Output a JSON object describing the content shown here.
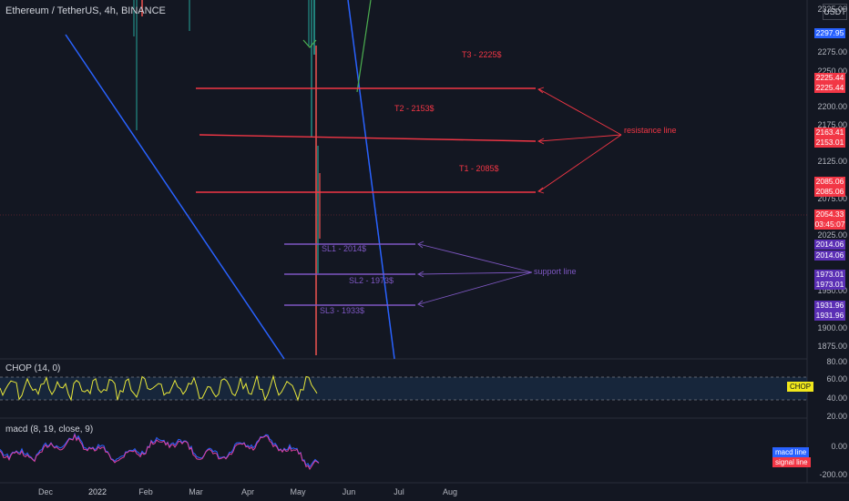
{
  "header": {
    "symbol": "Ethereum / TetherUS, 4h, BINANCE"
  },
  "settings_label": "USDT",
  "price_axis": {
    "ticks": [
      "2325.00",
      "2275.00",
      "2250.00",
      "2200.00",
      "2175.00",
      "2125.00",
      "2075.00",
      "2025.00",
      "1950.00",
      "1900.00",
      "1875.00"
    ],
    "badges": [
      {
        "text": "2297.95",
        "color": "#2962ff"
      },
      {
        "text": "2225.44",
        "color": "#f23645"
      },
      {
        "text": "2225.44",
        "color": "#f23645"
      },
      {
        "text": "2163.41",
        "color": "#f23645"
      },
      {
        "text": "2153.01",
        "color": "#f23645"
      },
      {
        "text": "2085.06",
        "color": "#f23645"
      },
      {
        "text": "2085.06",
        "color": "#f23645"
      },
      {
        "text": "2054.33",
        "color": "#f23645"
      },
      {
        "text": "03:45:07",
        "color": "#f23645"
      },
      {
        "text": "2014.06",
        "color": "#5b2fb5"
      },
      {
        "text": "2014.06",
        "color": "#5b2fb5"
      },
      {
        "text": "1973.01",
        "color": "#5b2fb5"
      },
      {
        "text": "1973.01",
        "color": "#5b2fb5"
      },
      {
        "text": "1931.96",
        "color": "#5b2fb5"
      },
      {
        "text": "1931.96",
        "color": "#5b2fb5"
      }
    ]
  },
  "time_axis": {
    "ticks": [
      "Dec",
      "2022",
      "Feb",
      "Mar",
      "Apr",
      "May",
      "Jun",
      "Jul",
      "Aug"
    ]
  },
  "annotations": {
    "targets": [
      "T3 - 2225$",
      "T2 - 2153$",
      "T1 - 2085$"
    ],
    "stops": [
      "SL1 - 2014$",
      "SL2 - 1973$",
      "SL3 - 1933$"
    ],
    "resistance": "resistance line",
    "support": "support line"
  },
  "chop": {
    "label": "CHOP (14, 0)",
    "ticks": [
      "80.00",
      "60.00",
      "40.00",
      "20.00"
    ],
    "tag": "CHOP"
  },
  "macd": {
    "label": "macd (8, 19, close, 9)",
    "ticks": [
      "0.00",
      "-200.00"
    ],
    "legend": [
      "macd line",
      "signal line"
    ]
  },
  "chart_data": [
    {
      "type": "line",
      "title": "Ethereum / TetherUS, 4h, BINANCE",
      "ylim": [
        1860,
        2340
      ],
      "price_levels": [
        {
          "label": "T3 - 2225$",
          "value": 2225.44,
          "color": "#f23645"
        },
        {
          "label": "T2 - 2153$",
          "value": 2153.01,
          "color": "#f23645"
        },
        {
          "label": "T1 - 2085$",
          "value": 2085.06,
          "color": "#f23645"
        },
        {
          "label": "SL1 - 2014$",
          "value": 2014.06,
          "color": "#7e57c2"
        },
        {
          "label": "SL2 - 1973$",
          "value": 1973.01,
          "color": "#7e57c2"
        },
        {
          "label": "SL3 - 1933$",
          "value": 1931.96,
          "color": "#7e57c2"
        }
      ],
      "last_price": 2054.33
    },
    {
      "type": "line",
      "title": "CHOP (14, 0)",
      "ylim": [
        20,
        80
      ],
      "band": [
        38.2,
        61.8
      ]
    },
    {
      "type": "line",
      "title": "macd (8, 19, close, 9)",
      "series": [
        {
          "name": "macd line",
          "color": "#2962ff"
        },
        {
          "name": "signal line",
          "color": "#f23645"
        }
      ]
    }
  ]
}
